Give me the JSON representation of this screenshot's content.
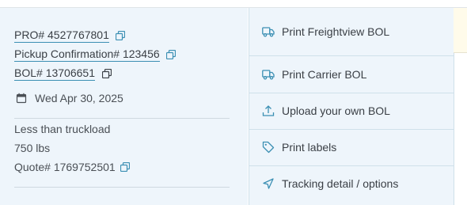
{
  "shipment": {
    "pro": "PRO# 4527767801",
    "pickup_confirmation": "Pickup Confirmation# 123456",
    "bol": "BOL# 13706651",
    "date": "Wed Apr 30, 2025",
    "mode": "Less than truckload",
    "weight": "750 lbs",
    "quote": "Quote# 1769752501"
  },
  "actions": [
    {
      "label": "Print Freightview BOL",
      "icon": "truck-icon"
    },
    {
      "label": "Print Carrier BOL",
      "icon": "truck-icon"
    },
    {
      "label": "Upload your own BOL",
      "icon": "upload-icon"
    },
    {
      "label": "Print labels",
      "icon": "tag-icon"
    },
    {
      "label": "Tracking detail / options",
      "icon": "location-arrow-icon"
    }
  ],
  "colors": {
    "panel_bg": "#eef5fb",
    "accent": "#3b8fb3",
    "notice_bg": "#fffbea"
  }
}
